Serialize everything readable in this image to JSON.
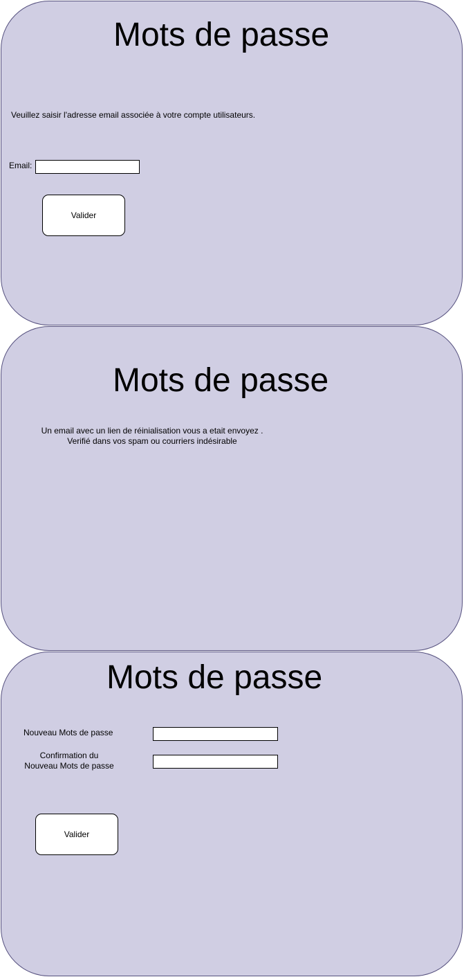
{
  "screen1": {
    "title": "Mots de passe",
    "instruction": "Veuillez saisir l'adresse email associée à votre compte utilisateurs.",
    "email_label": "Email:",
    "email_value": "",
    "submit_label": "Valider"
  },
  "screen2": {
    "title": "Mots de passe",
    "message_line1": "Un email avec un lien de réinialisation vous a etait envoyez .",
    "message_line2": "Verifié dans vos spam ou courriers indésirable"
  },
  "screen3": {
    "title": "Mots de passe",
    "new_password_label": "Nouveau Mots de passe",
    "new_password_value": "",
    "confirm_label_line1": "Confirmation du",
    "confirm_label_line2": "Nouveau Mots de passe",
    "confirm_value": "",
    "submit_label": "Valider"
  },
  "colors": {
    "card_fill": "#d0cee3",
    "card_border": "#56517f"
  }
}
